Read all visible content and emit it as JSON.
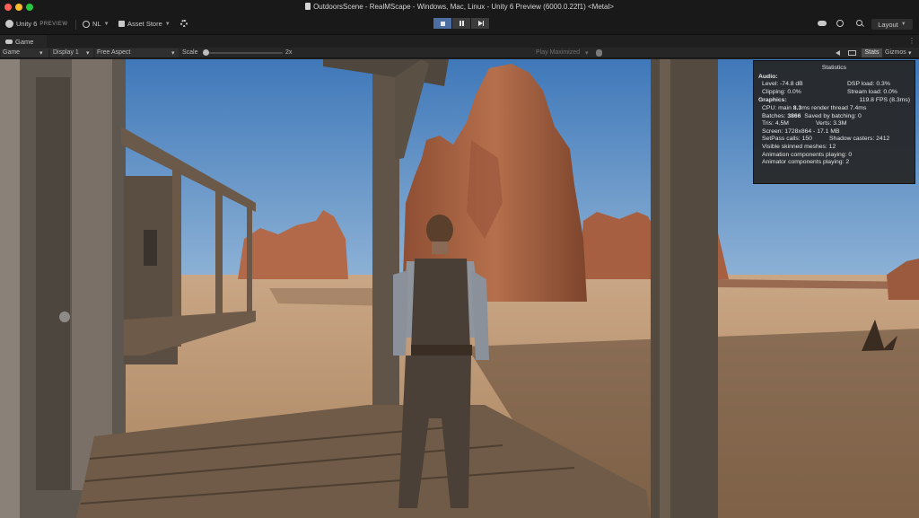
{
  "window": {
    "title": "OutdoorsScene - RealMScape - Windows, Mac, Linux - Unity 6 Preview (6000.0.22f1) <Metal>"
  },
  "toolbar": {
    "product": "Unity 6",
    "preview_tag": "PREVIEW",
    "account": "NL",
    "asset_store": "Asset Store",
    "layout": "Layout"
  },
  "game_tab": {
    "label": "Game"
  },
  "game_toolbar": {
    "display_mode": "Game",
    "display": "Display 1",
    "aspect": "Free Aspect",
    "scale_label": "Scale",
    "scale_value": "2x",
    "play_mode": "Play Maximized",
    "stats": "Stats",
    "gizmos": "Gizmos"
  },
  "statistics": {
    "title": "Statistics",
    "audio_label": "Audio:",
    "level": "Level: -74.8 dB",
    "dsp_load": "DSP load: 0.3%",
    "clipping": "Clipping: 0.0%",
    "stream_load": "Stream load: 0.0%",
    "graphics_label": "Graphics:",
    "fps": "119.8 FPS (8.3ms)",
    "cpu_prefix": "CPU: main ",
    "cpu_main": "8.3",
    "cpu_suffix": "ms  render thread 7.4ms",
    "batches_prefix": "Batches: ",
    "batches": "3866",
    "saved_batching": "Saved by batching: 0",
    "tris": "Tris: 4.5M",
    "verts": "Verts: 3.3M",
    "screen": "Screen: 1728x864 - 17.1 MB",
    "setpass": "SetPass calls: 150",
    "shadow_casters": "Shadow casters: 2412",
    "skinned_meshes": "Visible skinned meshes: 12",
    "anim_components": "Animation components playing: 0",
    "animator_components": "Animator components playing: 2"
  },
  "colors": {
    "play_active": "#4d6ea3",
    "sky": "#4f86c2",
    "sand": "#b89474",
    "rock": "#a4603f"
  }
}
